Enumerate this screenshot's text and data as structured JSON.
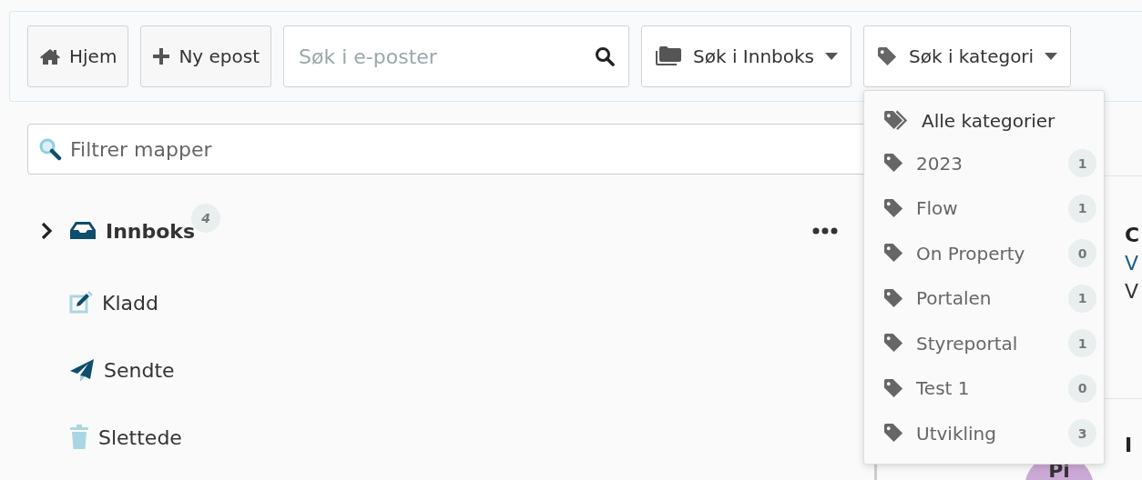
{
  "toolbar": {
    "buttons": [
      {
        "kind": "home",
        "label": "Hjem"
      },
      {
        "kind": "compose",
        "label": "Ny epost"
      }
    ],
    "search": {
      "placeholder": "Søk i e-poster"
    },
    "dropdowns": [
      {
        "kind": "folder",
        "label": "Søk i Innboks"
      },
      {
        "kind": "tag",
        "label": "Søk i kategori"
      }
    ]
  },
  "category_menu": {
    "items": [
      {
        "kind": "all",
        "label": "Alle kategorier"
      },
      {
        "kind": "tag",
        "label": "2023",
        "count": "1"
      },
      {
        "kind": "tag",
        "label": "Flow",
        "count": "1"
      },
      {
        "kind": "tag",
        "label": "On Property",
        "count": "0"
      },
      {
        "kind": "tag",
        "label": "Portalen",
        "count": "1"
      },
      {
        "kind": "tag",
        "label": "Styreportal",
        "count": "1"
      },
      {
        "kind": "tag",
        "label": "Test 1",
        "count": "0"
      },
      {
        "kind": "tag",
        "label": "Utvikling",
        "count": "3"
      }
    ]
  },
  "folder_filter": {
    "placeholder": "Filtrer mapper"
  },
  "folders": [
    {
      "kind": "inbox",
      "label": "Innboks",
      "expanded": false,
      "unread": true,
      "badge": "4"
    },
    {
      "kind": "drafts",
      "label": "Kladd",
      "unread": false
    },
    {
      "kind": "sent",
      "label": "Sendte",
      "unread": false
    },
    {
      "kind": "trash",
      "label": "Slettede",
      "unread": false
    }
  ],
  "message_list": {
    "rows": [
      {
        "lines": [
          {
            "kind": "subject",
            "text": "C"
          },
          {
            "kind": "link",
            "text": "V"
          },
          {
            "kind": "plain",
            "text": "V"
          }
        ]
      },
      {
        "lines": [
          {
            "kind": "subject",
            "text": "I"
          }
        ],
        "avatar": "Pi"
      }
    ]
  }
}
